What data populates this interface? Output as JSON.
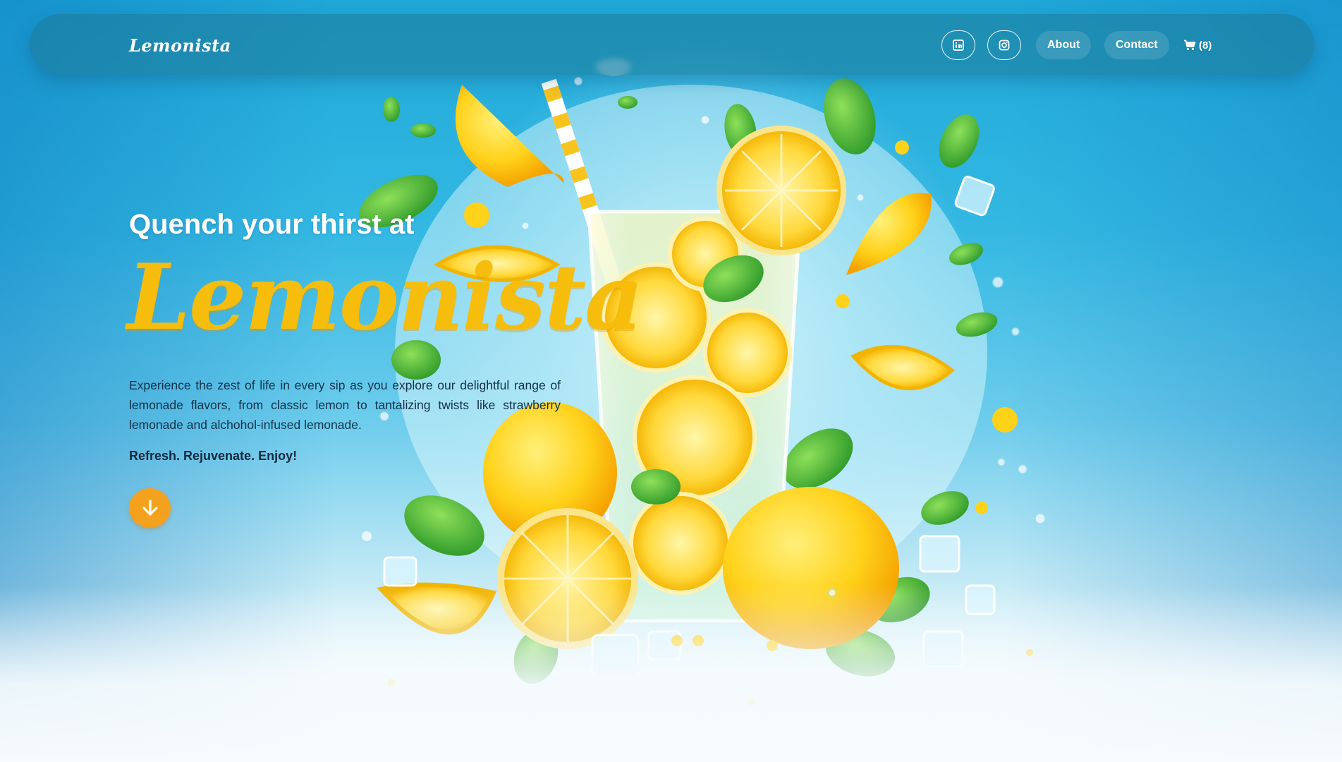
{
  "brand": {
    "name": "Lemonista"
  },
  "nav": {
    "linkedin_icon": "linkedin-icon",
    "instagram_icon": "instagram-icon",
    "about_label": "About",
    "contact_label": "Contact",
    "cart_icon": "cart-icon",
    "cart_count": "(8)"
  },
  "hero": {
    "subtitle": "Quench your thirst at",
    "title": "Lemonista",
    "description": "Experience the zest of life in every sip as you explore our delightful range of lemonade flavors, from classic lemon to tantalizing twists like strawberry lemonade and alchohol-infused lemonade.",
    "tagline": "Refresh. Rejuvenate. Enjoy!",
    "scroll_icon": "arrow-down-icon"
  },
  "colors": {
    "accent": "#f4a21d",
    "title_yellow": "#f6bd0c",
    "sky_blue": "#1fa7d8"
  }
}
